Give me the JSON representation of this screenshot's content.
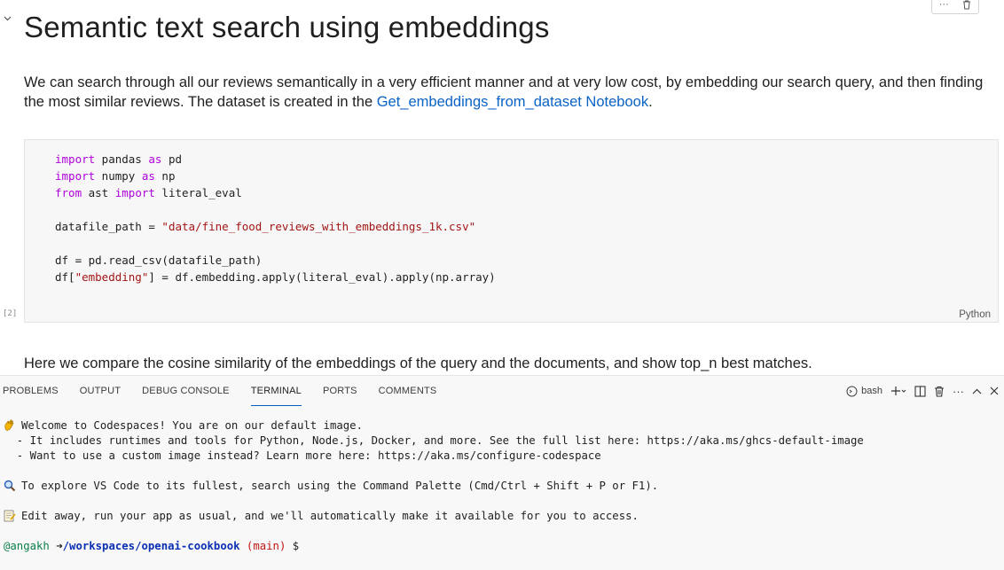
{
  "notebook": {
    "title": "Semantic text search using embeddings",
    "intro_text": "We can search through all our reviews semantically in a very efficient manner and at very low cost, by embedding our search query, and then finding the most similar reviews. The dataset is created in the ",
    "intro_link": "Get_embeddings_from_dataset Notebook",
    "intro_end": ".",
    "code_cell": {
      "execution_count": "[2]",
      "language": "Python",
      "lines": [
        [
          {
            "t": "import",
            "c": "kw"
          },
          {
            "t": " pandas "
          },
          {
            "t": "as",
            "c": "kw"
          },
          {
            "t": " pd"
          }
        ],
        [
          {
            "t": "import",
            "c": "kw"
          },
          {
            "t": " numpy "
          },
          {
            "t": "as",
            "c": "kw"
          },
          {
            "t": " np"
          }
        ],
        [
          {
            "t": "from",
            "c": "kw"
          },
          {
            "t": " ast "
          },
          {
            "t": "import",
            "c": "kw"
          },
          {
            "t": " literal_eval"
          }
        ],
        [],
        [
          {
            "t": "datafile_path = "
          },
          {
            "t": "\"data/fine_food_reviews_with_embeddings_1k.csv\"",
            "c": "str"
          }
        ],
        [],
        [
          {
            "t": "df = pd.read_csv(datafile_path)"
          }
        ],
        [
          {
            "t": "df["
          },
          {
            "t": "\"embedding\"",
            "c": "str"
          },
          {
            "t": "] = df.embedding.apply(literal_eval).apply(np.array)"
          }
        ]
      ]
    },
    "next_text": "Here we compare the cosine similarity of the embeddings of the query and the documents, and show top_n best matches."
  },
  "panel": {
    "tabs": [
      "PROBLEMS",
      "OUTPUT",
      "DEBUG CONSOLE",
      "TERMINAL",
      "PORTS",
      "COMMENTS"
    ],
    "active_tab": "TERMINAL",
    "shell_label": "bash",
    "terminal": {
      "welcome": "Welcome to Codespaces! You are on our default image.",
      "bullet1": "  - It includes runtimes and tools for Python, Node.js, Docker, and more. See the full list here: https://aka.ms/ghcs-default-image",
      "bullet2": "  - Want to use a custom image instead? Learn more here: https://aka.ms/configure-codespace",
      "explore": "To explore VS Code to its fullest, search using the Command Palette (Cmd/Ctrl + Shift + P or F1).",
      "edit": "Edit away, run your app as usual, and we'll automatically make it available for you to access.",
      "prompt_user": "@angakh",
      "prompt_arrow": " ➜",
      "prompt_path": "/workspaces/openai-cookbook",
      "prompt_branch_open": " (",
      "prompt_branch": "main",
      "prompt_branch_close": ")",
      "prompt_symbol": " $"
    }
  },
  "colors": {
    "accent": "#005fb8",
    "link": "#0b63c6",
    "keyword": "#af00db",
    "string": "#a31515"
  },
  "icons": [
    "chevron-down-icon",
    "more-icon",
    "trash-icon",
    "terminal-icon",
    "plus-icon",
    "split-icon",
    "close-icon",
    "maximize-icon",
    "wave-emoji-icon",
    "magnifier-emoji-icon",
    "memo-emoji-icon"
  ]
}
